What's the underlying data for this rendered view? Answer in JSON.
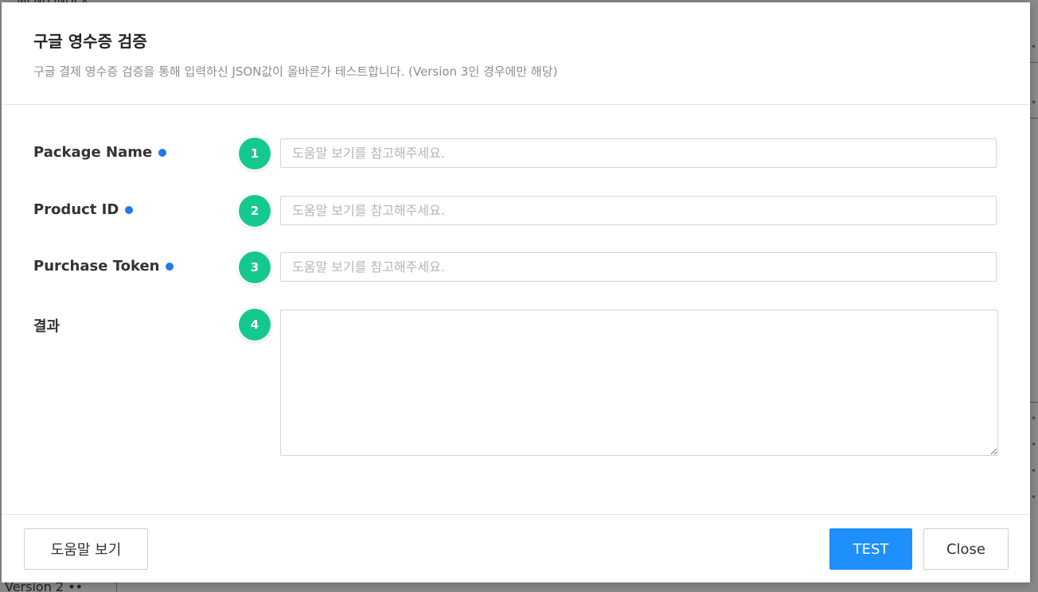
{
  "background": {
    "top_text": "ㅡ MENU INDEX",
    "bottom_text": "Version 2 ••",
    "right_marker": "*"
  },
  "modal": {
    "title": "구글 영수증 검증",
    "description": "구글 결제 영수증 검증을 통해 입력하신 JSON값이 올바른가 테스트합니다. (Version 3인 경우에만 해당)"
  },
  "fields": [
    {
      "label": "Package Name",
      "required": true,
      "step": "1",
      "placeholder": "도움말 보기를 참고해주세요.",
      "value": ""
    },
    {
      "label": "Product ID",
      "required": true,
      "step": "2",
      "placeholder": "도움말 보기를 참고해주세요.",
      "value": ""
    },
    {
      "label": "Purchase Token",
      "required": true,
      "step": "3",
      "placeholder": "도움말 보기를 참고해주세요.",
      "value": ""
    }
  ],
  "result": {
    "label": "결과",
    "step": "4",
    "value": ""
  },
  "footer": {
    "help_label": "도움말 보기",
    "test_label": "TEST",
    "close_label": "Close"
  },
  "colors": {
    "accent_blue": "#1e8ffb",
    "required_dot": "#1e7be8",
    "step_badge": "#15c98e"
  }
}
